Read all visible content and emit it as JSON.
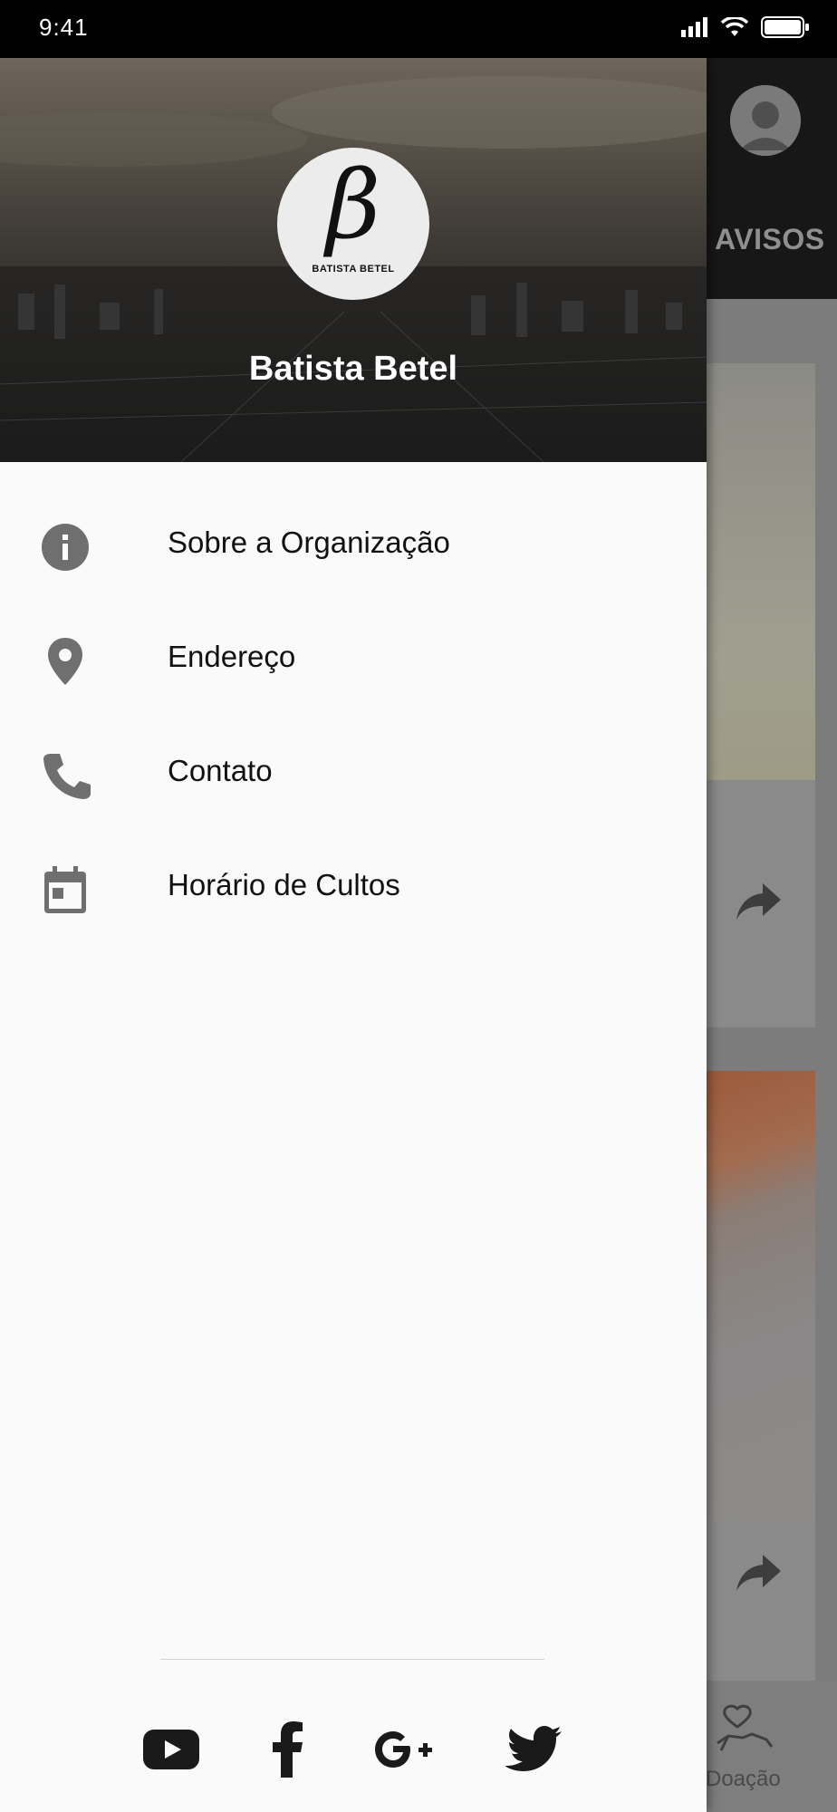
{
  "status_bar": {
    "time": "9:41",
    "icons": [
      "signal-icon",
      "wifi-icon",
      "battery-icon"
    ]
  },
  "background_app": {
    "tab_label": "AVISOS",
    "bottom_nav_label": "Doação",
    "icons": [
      "avatar-icon",
      "share-icon",
      "donation-icon"
    ]
  },
  "drawer": {
    "logo_text": "BATISTA BETEL",
    "logo_glyph": "β",
    "title": "Batista Betel",
    "menu": [
      {
        "label": "Sobre a Organização",
        "icon": "info-icon"
      },
      {
        "label": "Endereço",
        "icon": "location-pin-icon"
      },
      {
        "label": "Contato",
        "icon": "phone-icon"
      },
      {
        "label": "Horário de Cultos",
        "icon": "calendar-icon"
      }
    ],
    "social": [
      "youtube-icon",
      "facebook-icon",
      "google-plus-icon",
      "twitter-icon"
    ]
  },
  "colors": {
    "drawer_bg": "#fafafa",
    "icon_gray": "#6f6f6f",
    "scrim": "#7a7a7a",
    "status_bar": "#000000"
  }
}
